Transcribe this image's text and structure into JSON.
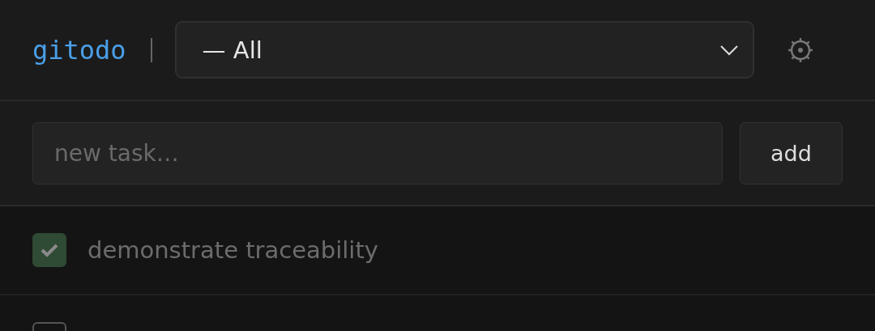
{
  "header": {
    "logo": "gitodo",
    "filter": {
      "value": "— All"
    }
  },
  "new_task": {
    "placeholder": "new task…",
    "button": "add"
  },
  "tasks": [
    {
      "text": "demonstrate traceability",
      "checked": true
    },
    {
      "checked": false
    }
  ]
}
